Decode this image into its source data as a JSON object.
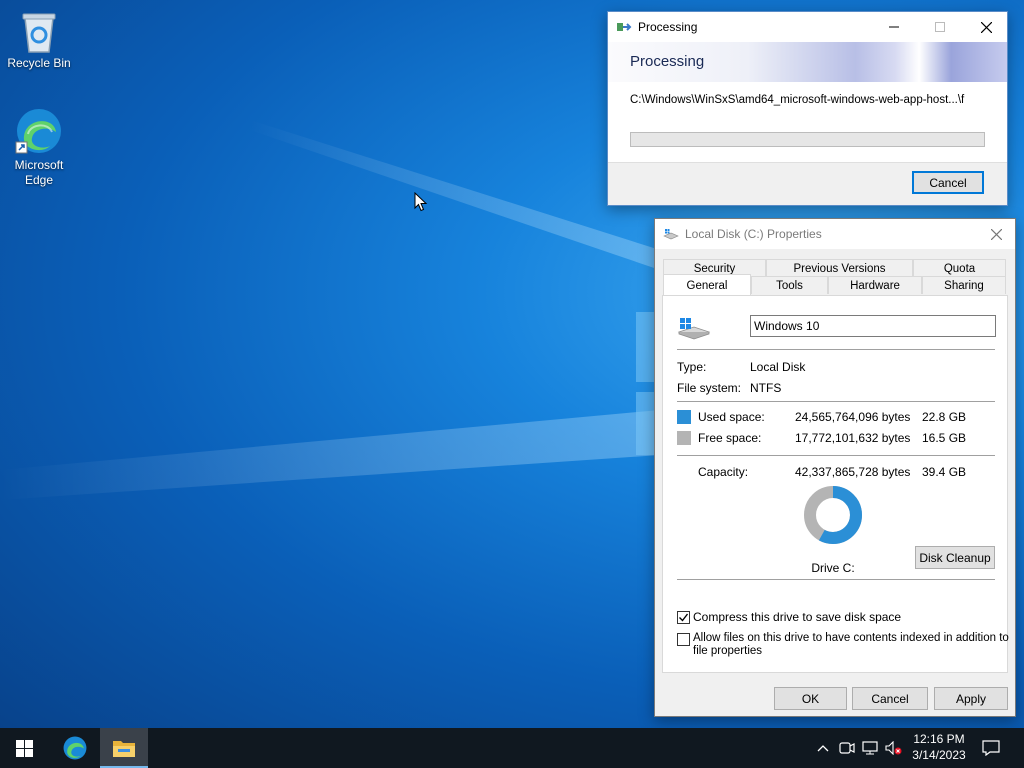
{
  "desktop": {
    "icons": [
      {
        "label": "Recycle Bin"
      },
      {
        "label": "Microsoft Edge"
      }
    ]
  },
  "processing": {
    "window_title": "Processing",
    "banner_title": "Processing",
    "path": "C:\\Windows\\WinSxS\\amd64_microsoft-windows-web-app-host...\\f",
    "progress": 0,
    "cancel_label": "Cancel"
  },
  "properties": {
    "window_title": "Local Disk (C:) Properties",
    "tabs_back": [
      "Security",
      "Previous Versions",
      "Quota"
    ],
    "tabs_front": [
      "General",
      "Tools",
      "Hardware",
      "Sharing"
    ],
    "volume_name": "Windows 10",
    "type_label": "Type:",
    "type_value": "Local Disk",
    "fs_label": "File system:",
    "fs_value": "NTFS",
    "used_label": "Used space:",
    "used_bytes": "24,565,764,096 bytes",
    "used_gb": "22.8 GB",
    "free_label": "Free space:",
    "free_bytes": "17,772,101,632 bytes",
    "free_gb": "16.5 GB",
    "capacity_label": "Capacity:",
    "capacity_bytes": "42,337,865,728 bytes",
    "capacity_gb": "39.4 GB",
    "drive_label": "Drive C:",
    "disk_cleanup_label": "Disk Cleanup",
    "compress_label": "Compress this drive to save disk space",
    "compress_checked": true,
    "index_label_line1": "Allow files on this drive to have contents indexed in addition to",
    "index_label_line2": "file properties",
    "index_checked": false,
    "used_fraction": 0.58,
    "used_color": "#2b8fd6",
    "free_color": "#b4b4b4",
    "ok_label": "OK",
    "cancel_label": "Cancel",
    "apply_label": "Apply"
  },
  "taskbar": {
    "time": "12:16 PM",
    "date": "3/14/2023",
    "icons": [
      "windows-start-icon",
      "edge-icon",
      "file-explorer-icon",
      "chevron-up-icon",
      "meet-now-icon",
      "network-icon",
      "volume-muted-icon",
      "notification-icon"
    ]
  }
}
